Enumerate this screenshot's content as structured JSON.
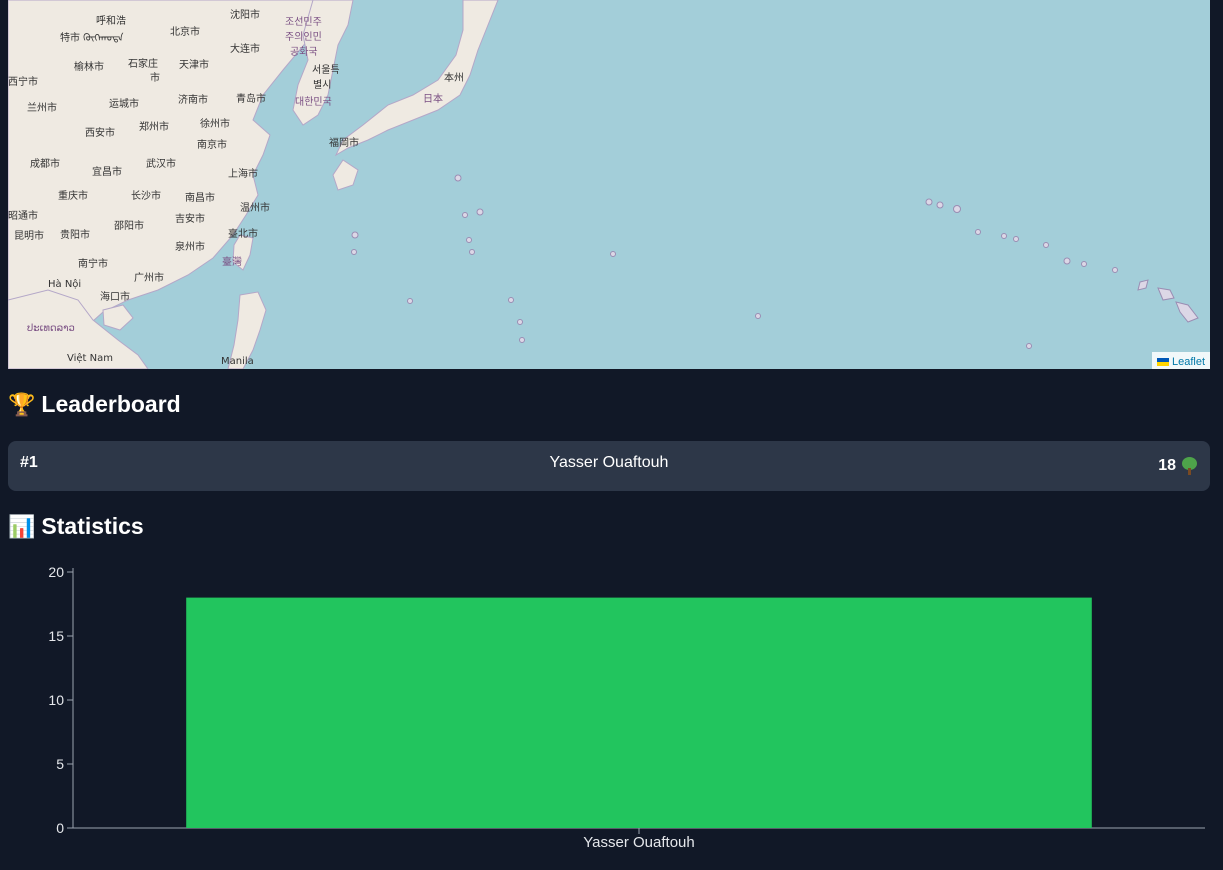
{
  "map": {
    "attribution": "Leaflet",
    "labels": [
      {
        "text": "呼和浩"
      },
      {
        "text": "沈阳市"
      },
      {
        "text": "조선민주"
      },
      {
        "text": "주의인민"
      },
      {
        "text": "공화국"
      },
      {
        "text": "特市 ᠬᠥᠬᠡᠬᠣᠲᠠ"
      },
      {
        "text": "北京市"
      },
      {
        "text": "大连市"
      },
      {
        "text": "서울특"
      },
      {
        "text": "별시"
      },
      {
        "text": "榆林市"
      },
      {
        "text": "石家庄"
      },
      {
        "text": "市"
      },
      {
        "text": "天津市"
      },
      {
        "text": "대한민국"
      },
      {
        "text": "西宁市"
      },
      {
        "text": "兰州市"
      },
      {
        "text": "运城市"
      },
      {
        "text": "济南市"
      },
      {
        "text": "青岛市"
      },
      {
        "text": "西安市"
      },
      {
        "text": "郑州市"
      },
      {
        "text": "徐州市"
      },
      {
        "text": "南京市"
      },
      {
        "text": "福岡市"
      },
      {
        "text": "本州"
      },
      {
        "text": "日本"
      },
      {
        "text": "成都市"
      },
      {
        "text": "宜昌市"
      },
      {
        "text": "武汉市"
      },
      {
        "text": "上海市"
      },
      {
        "text": "重庆市"
      },
      {
        "text": "长沙市"
      },
      {
        "text": "南昌市"
      },
      {
        "text": "温州市"
      },
      {
        "text": "昭通市"
      },
      {
        "text": "邵阳市"
      },
      {
        "text": "吉安市"
      },
      {
        "text": "昆明市"
      },
      {
        "text": "贵阳市"
      },
      {
        "text": "臺北市"
      },
      {
        "text": "泉州市"
      },
      {
        "text": "臺灣"
      },
      {
        "text": "南宁市"
      },
      {
        "text": "广州市"
      },
      {
        "text": "Hà Nội"
      },
      {
        "text": "海口市"
      },
      {
        "text": "ປະເທດລາວ"
      },
      {
        "text": "Việt Nam"
      },
      {
        "text": "Manila"
      }
    ]
  },
  "leaderboard": {
    "heading": "Leaderboard",
    "heading_icon": "🏆",
    "entries": [
      {
        "rank": "#1",
        "name": "Yasser Ouaftouh",
        "score": "18",
        "icon": "tree-icon"
      }
    ]
  },
  "statistics": {
    "heading": "Statistics",
    "heading_icon": "📊"
  },
  "chart_data": {
    "type": "bar",
    "categories": [
      "Yasser Ouaftouh"
    ],
    "values": [
      18
    ],
    "ylim": [
      0,
      20
    ],
    "yticks": [
      0,
      5,
      10,
      15,
      20
    ],
    "bar_color": "#22c55e",
    "axis_color": "#9ca3af",
    "xlabel": "",
    "ylabel": "",
    "title": ""
  }
}
